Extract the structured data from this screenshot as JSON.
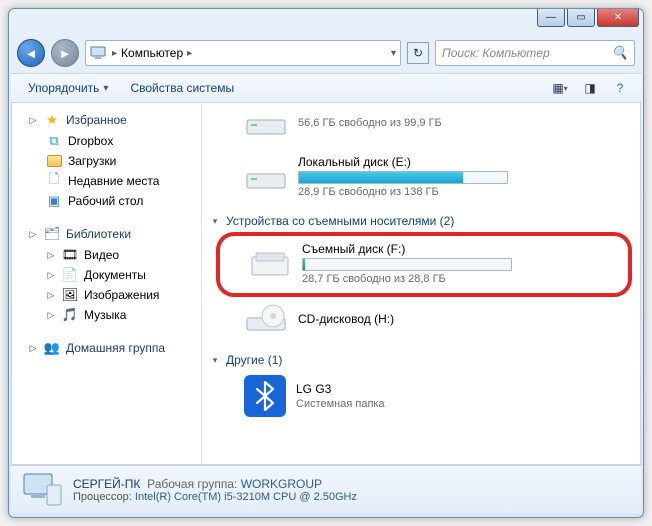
{
  "breadcrumb": {
    "root_icon": "computer-icon",
    "root": "Компьютер"
  },
  "search": {
    "placeholder": "Поиск: Компьютер"
  },
  "toolbar": {
    "organize": "Упорядочить",
    "sys_props": "Свойства системы"
  },
  "nav": {
    "favorites": {
      "label": "Избранное",
      "items": [
        "Dropbox",
        "Загрузки",
        "Недавние места",
        "Рабочий стол"
      ]
    },
    "libraries": {
      "label": "Библиотеки",
      "items": [
        "Видео",
        "Документы",
        "Изображения",
        "Музыка"
      ]
    },
    "homegroup": {
      "label": "Домашняя группа"
    }
  },
  "content": {
    "drive_top_free": "56,6 ГБ свободно из 99,9 ГБ",
    "drive_e": {
      "name": "Локальный диск (E:)",
      "free": "28,9 ГБ свободно из 138 ГБ",
      "fill_pct": 79
    },
    "removable_header": "Устройства со съемными носителями (2)",
    "drive_f": {
      "name": "Съемный диск (F:)",
      "free": "28,7 ГБ свободно из 28,8 ГБ",
      "fill_pct": 1
    },
    "cd": {
      "name": "CD-дисковод (H:)"
    },
    "other_header": "Другие (1)",
    "lg": {
      "name": "LG G3",
      "sub": "Системная папка"
    }
  },
  "details": {
    "computer_name": "СЕРГЕЙ-ПК",
    "workgroup_label": "Рабочая группа:",
    "workgroup": "WORKGROUP",
    "cpu_label": "Процессор:",
    "cpu": "Intel(R) Core(TM) i5-3210M CPU @ 2.50GHz"
  }
}
